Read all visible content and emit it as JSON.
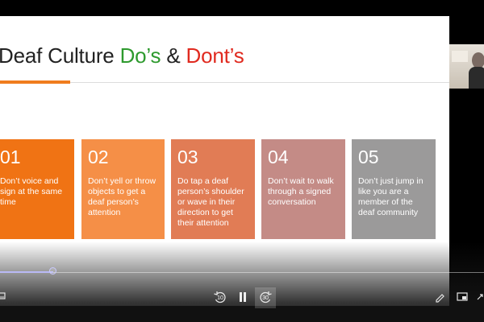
{
  "slide": {
    "title": {
      "prefix": "Deaf Culture ",
      "dos": "Do’s",
      "amp": " & ",
      "donts": "Dont’s"
    },
    "cards": [
      {
        "num": "01",
        "text": "Don’t voice and sign at the same time"
      },
      {
        "num": "02",
        "text": "Don’t yell or throw objects to get a deaf person’s attention"
      },
      {
        "num": "03",
        "text": "Do tap a deaf person’s shoulder or wave in their direction to get their attention"
      },
      {
        "num": "04",
        "text": "Don’t wait to walk through a signed conversation"
      },
      {
        "num": "05",
        "text": "Don’t just jump in like you are a member of the deaf community"
      }
    ]
  },
  "player": {
    "progress_fraction": 0.11,
    "skip_back_label": "10",
    "skip_forward_label": "30",
    "icons": [
      "captions-icon",
      "skip-back-10-icon",
      "pause-icon",
      "skip-forward-30-icon",
      "pen-icon",
      "miniplayer-icon",
      "expand-icon"
    ]
  },
  "colors": {
    "accent_orange": "#f07314",
    "dos_green": "#2e9a2e",
    "donts_red": "#e02a1f"
  }
}
